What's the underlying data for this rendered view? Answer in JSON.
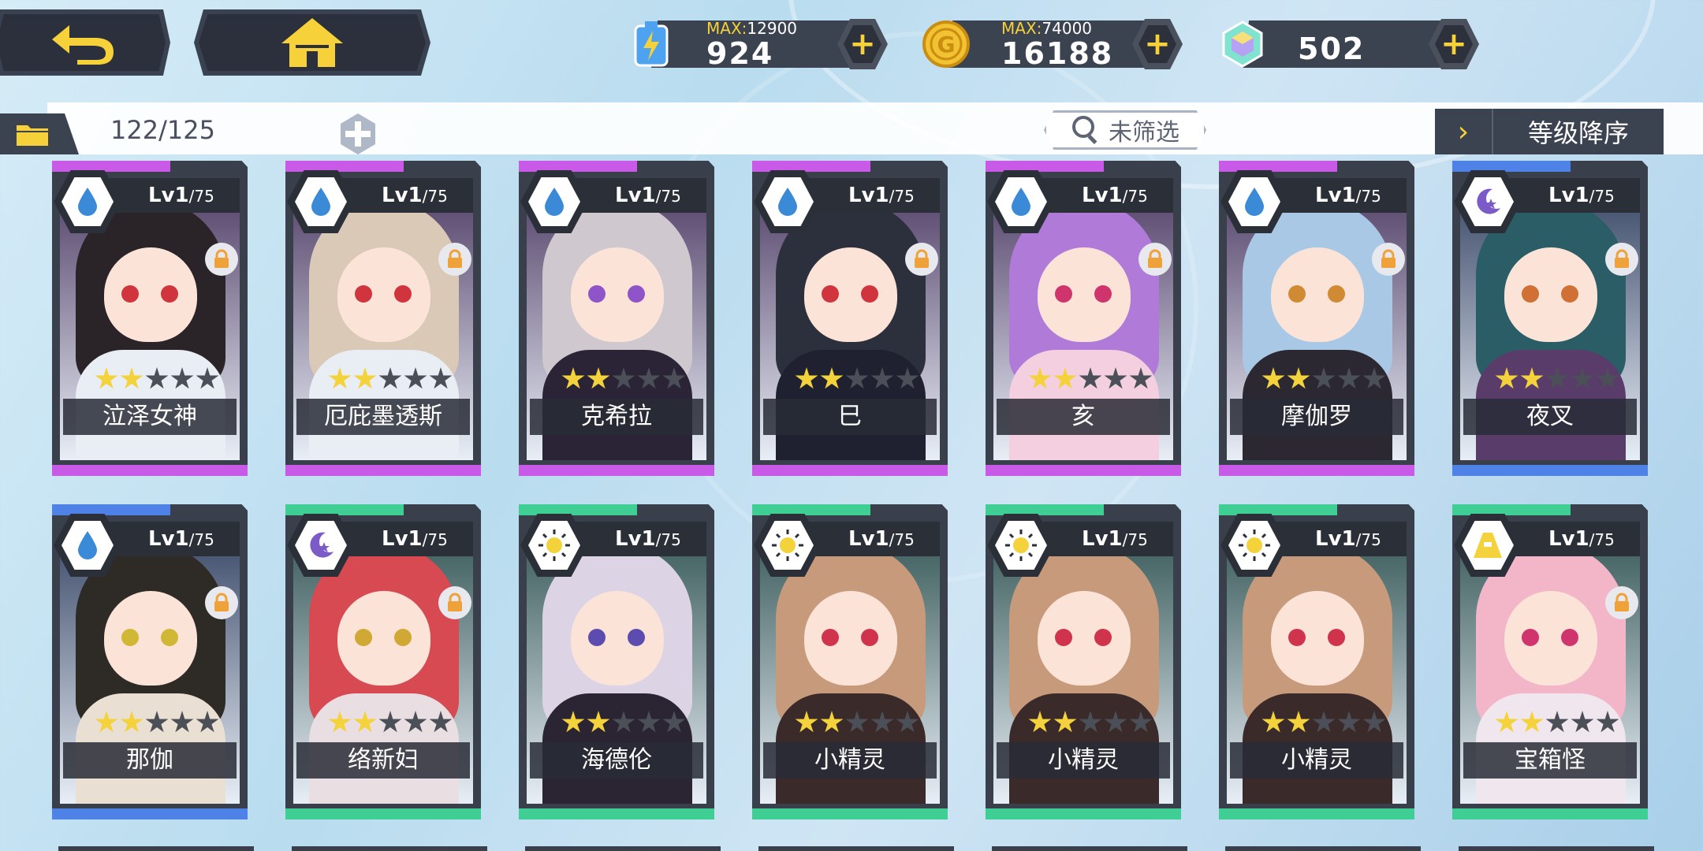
{
  "top": {
    "back_button_label": "back",
    "home_button_label": "home",
    "resources": [
      {
        "name": "stamina",
        "icon": "battery-icon",
        "max_label": "MAX:",
        "max_value": "12900",
        "value": "924"
      },
      {
        "name": "gold",
        "icon": "coin-icon",
        "max_label": "MAX:",
        "max_value": "74000",
        "value": "16188"
      },
      {
        "name": "gems",
        "icon": "gem-icon",
        "value": "502"
      }
    ]
  },
  "toolbar": {
    "count": "122/125",
    "filter_label": "未筛选",
    "sort_label": "等级降序"
  },
  "colors": {
    "water": "#3b8ad8",
    "moon": "#7b5bc8",
    "sun": "#f3d23c",
    "earth": "#f3d23c",
    "band_purple": "#c95ae8",
    "band_blue": "#4f82e6",
    "band_green": "#3fcf95",
    "star_on": "#f3d23c"
  },
  "cards": [
    {
      "name": "泣泽女神",
      "level_prefix": "Lv1",
      "level_max": "/75",
      "element": "water",
      "band": "purple",
      "stars": 2,
      "locked": true
    },
    {
      "name": "厄庇墨透斯",
      "level_prefix": "Lv1",
      "level_max": "/75",
      "element": "water",
      "band": "purple",
      "stars": 2,
      "locked": true
    },
    {
      "name": "克希拉",
      "level_prefix": "Lv1",
      "level_max": "/75",
      "element": "water",
      "band": "purple",
      "stars": 2,
      "locked": false
    },
    {
      "name": "巳",
      "level_prefix": "Lv1",
      "level_max": "/75",
      "element": "water",
      "band": "purple",
      "stars": 2,
      "locked": true
    },
    {
      "name": "亥",
      "level_prefix": "Lv1",
      "level_max": "/75",
      "element": "water",
      "band": "purple",
      "stars": 2,
      "locked": true
    },
    {
      "name": "摩伽罗",
      "level_prefix": "Lv1",
      "level_max": "/75",
      "element": "water",
      "band": "purple",
      "stars": 2,
      "locked": true
    },
    {
      "name": "夜叉",
      "level_prefix": "Lv1",
      "level_max": "/75",
      "element": "moon",
      "band": "blue",
      "stars": 2,
      "locked": true
    },
    {
      "name": "那伽",
      "level_prefix": "Lv1",
      "level_max": "/75",
      "element": "water",
      "band": "blue",
      "stars": 2,
      "locked": true
    },
    {
      "name": "络新妇",
      "level_prefix": "Lv1",
      "level_max": "/75",
      "element": "moon",
      "band": "green",
      "stars": 2,
      "locked": true
    },
    {
      "name": "海德伦",
      "level_prefix": "Lv1",
      "level_max": "/75",
      "element": "sun",
      "band": "green",
      "stars": 2,
      "locked": false
    },
    {
      "name": "小精灵",
      "level_prefix": "Lv1",
      "level_max": "/75",
      "element": "sun",
      "band": "green",
      "stars": 2,
      "locked": false
    },
    {
      "name": "小精灵",
      "level_prefix": "Lv1",
      "level_max": "/75",
      "element": "sun",
      "band": "green",
      "stars": 2,
      "locked": false
    },
    {
      "name": "小精灵",
      "level_prefix": "Lv1",
      "level_max": "/75",
      "element": "sun",
      "band": "green",
      "stars": 2,
      "locked": false
    },
    {
      "name": "宝箱怪",
      "level_prefix": "Lv1",
      "level_max": "/75",
      "element": "earth",
      "band": "green",
      "stars": 2,
      "locked": true
    }
  ],
  "portraits": [
    {
      "hair": "#2a2328",
      "eye": "#d0343c",
      "outfit": "#e9eef5"
    },
    {
      "hair": "#d9c9b6",
      "eye": "#d0343c",
      "outfit": "#e9edf4"
    },
    {
      "hair": "#cfc9cf",
      "eye": "#8e54c8",
      "outfit": "#2b2436"
    },
    {
      "hair": "#2c2f3c",
      "eye": "#d0343c",
      "outfit": "#1f2130"
    },
    {
      "hair": "#b07ad8",
      "eye": "#d0346c",
      "outfit": "#f3cfe0"
    },
    {
      "hair": "#a9c8e6",
      "eye": "#d08a34",
      "outfit": "#2b2832"
    },
    {
      "hair": "#2a5d66",
      "eye": "#d07034",
      "outfit": "#5a3c6a"
    },
    {
      "hair": "#2e2a26",
      "eye": "#d0b834",
      "outfit": "#e9dfd2"
    },
    {
      "hair": "#d74a52",
      "eye": "#d0a834",
      "outfit": "#e9dfe2"
    },
    {
      "hair": "#dcd4e4",
      "eye": "#5c4cb0",
      "outfit": "#2b2432"
    },
    {
      "hair": "#c79a7c",
      "eye": "#d0344c",
      "outfit": "#3a2a2a"
    },
    {
      "hair": "#c79a7c",
      "eye": "#d0344c",
      "outfit": "#3a2a2a"
    },
    {
      "hair": "#c79a7c",
      "eye": "#d0344c",
      "outfit": "#3a2a2a"
    },
    {
      "hair": "#f2b6c8",
      "eye": "#d0346c",
      "outfit": "#f0e6ee"
    }
  ]
}
